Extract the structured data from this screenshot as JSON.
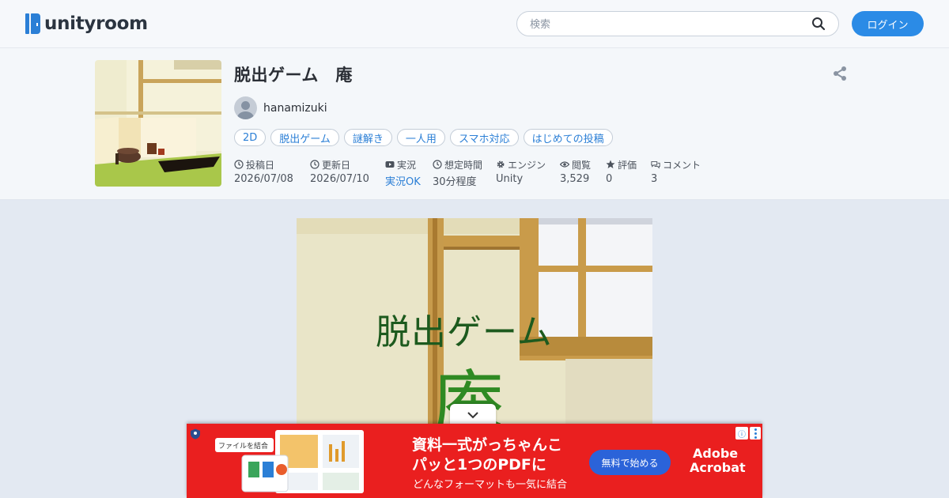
{
  "header": {
    "logo_text": "unityroom",
    "search_placeholder": "検索",
    "login_label": "ログイン"
  },
  "game": {
    "title": "脱出ゲーム　庵",
    "author": "hanamizuki",
    "tags": [
      "2D",
      "脱出ゲーム",
      "謎解き",
      "一人用",
      "スマホ対応",
      "はじめての投稿"
    ],
    "meta": {
      "posted": {
        "label": "投稿日",
        "value": "2026/07/08",
        "icon": "clock-icon"
      },
      "updated": {
        "label": "更新日",
        "value": "2026/07/10",
        "icon": "clock-icon"
      },
      "streaming": {
        "label": "実況",
        "value": "実況OK",
        "icon": "video-icon"
      },
      "playtime": {
        "label": "想定時間",
        "value": "30分程度",
        "icon": "clock-icon"
      },
      "engine": {
        "label": "エンジン",
        "value": "Unity",
        "icon": "gear-icon"
      },
      "views": {
        "label": "閲覧",
        "value": "3,529",
        "icon": "eye-icon"
      },
      "rating": {
        "label": "評価",
        "value": "0",
        "icon": "star-icon"
      },
      "comments": {
        "label": "コメント",
        "value": "3",
        "icon": "comment-icon"
      }
    },
    "canvas": {
      "title_text": "脱出ゲーム",
      "kanji": "庵"
    }
  },
  "ad": {
    "chip": "ファイルを結合",
    "line1": "資料一式がっちゃんこ",
    "line2": "パッと1つのPDFに",
    "line3": "どんなフォーマットも一気に結合",
    "cta": "無料で始める",
    "brand_line1": "Adobe",
    "brand_line2": "Acrobat",
    "info_glyph": "ⓘ"
  },
  "colors": {
    "accent": "#2b8be6",
    "link": "#2b7fd6",
    "ad_red": "#ea1f1f"
  }
}
